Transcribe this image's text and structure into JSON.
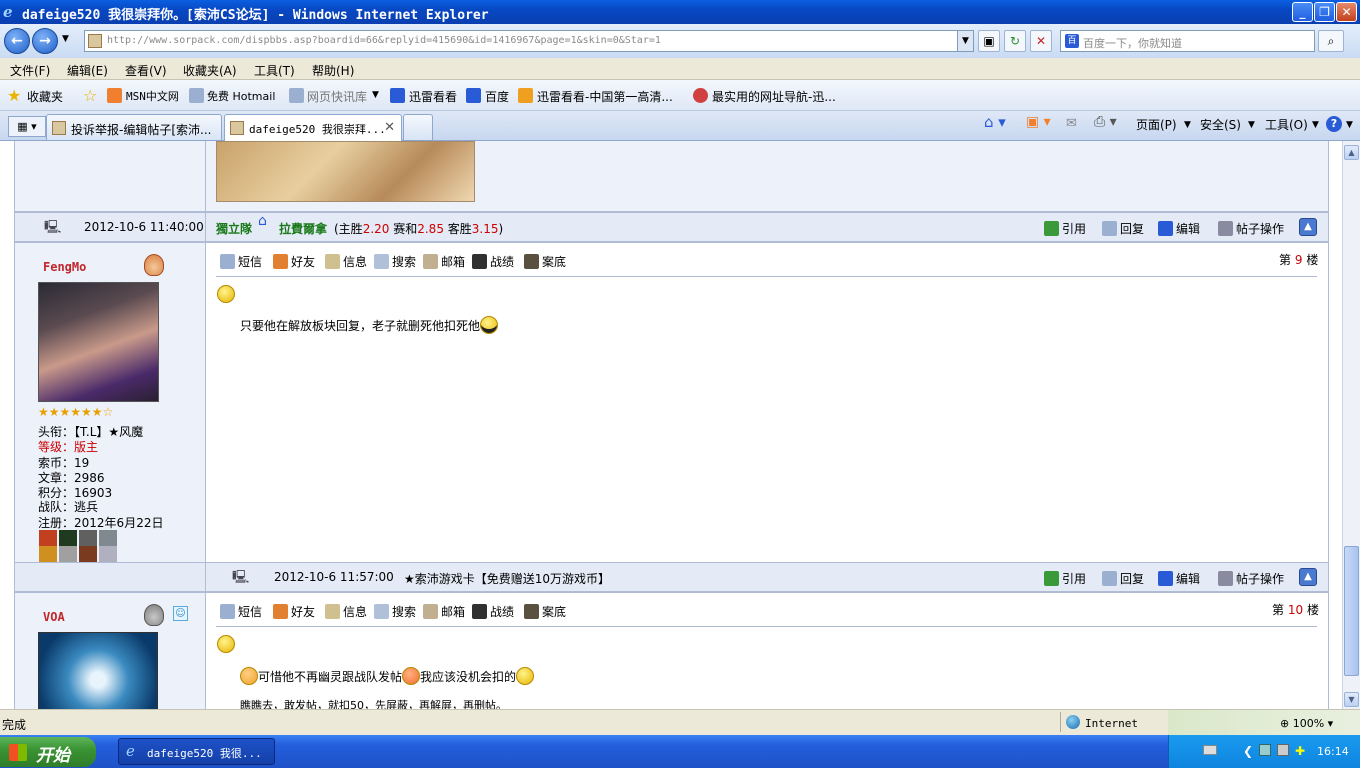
{
  "window": {
    "title": "dafeige520 我很崇拜你。[索沛CS论坛] - Windows Internet Explorer"
  },
  "address": {
    "url": "http://www.sorpack.com/dispbbs.asp?boardid=66&replyid=415690&id=1416967&page=1&skin=0&Star=1",
    "search_placeholder": "百度一下，你就知道"
  },
  "menu": [
    "文件(F)",
    "编辑(E)",
    "查看(V)",
    "收藏夹(A)",
    "工具(T)",
    "帮助(H)"
  ],
  "favorites": {
    "label": "收藏夹",
    "items": [
      "MSN中文网",
      "免费 Hotmail",
      "网页快讯库",
      "迅雷看看",
      "百度",
      "迅雷看看-中国第一高清...",
      "最实用的网址导航-迅..."
    ]
  },
  "tabs": [
    "投诉举报-编辑帖子[索沛...",
    "dafeige520 我很崇拜..."
  ],
  "commands": {
    "page": "页面(P)",
    "safety": "安全(S)",
    "tools": "工具(O)"
  },
  "post_actions": {
    "quote": "引用",
    "reply": "回复",
    "edit": "编辑",
    "manage": "帖子操作"
  },
  "user_actions": [
    "短信",
    "好友",
    "信息",
    "搜索",
    "邮箱",
    "战绩",
    "案底"
  ],
  "floor_prefix": "第",
  "floor_suffix": "楼",
  "post1": {
    "time": "2012-10-6 11:40:00",
    "sig_a": "獨立隊",
    "sig_b": "拉費爾拿",
    "sig_text1": "(主胜",
    "sig_v1": "2.20",
    "sig_text2": " 赛和",
    "sig_v2": "2.85",
    "sig_text3": " 客胜",
    "sig_v3": "3.15",
    "sig_text4": ")"
  },
  "post9": {
    "floor": "9",
    "user": "FengMo",
    "stars": "★★★★★★☆",
    "title_label": "头衔：",
    "title_value": "【T.L】★风魔",
    "level_label": "等级：",
    "level_value": "版主",
    "coins_label": "索币：",
    "coins_value": "19",
    "articles_label": "文章：",
    "articles_value": "2986",
    "points_label": "积分：",
    "points_value": "16903",
    "team_label": "战队：",
    "team_value": "逃兵",
    "reg_label": "注册：",
    "reg_value": "2012年6月22日",
    "body": "只要他在解放板块回复，老子就删死他扣死他"
  },
  "post9_footer": {
    "time": "2012-10-6 11:57:00",
    "sig": "★索沛游戏卡【免费赠送10万游戏币】"
  },
  "post10": {
    "floor": "10",
    "user": "VOA",
    "body1_a": "可惜他不再幽灵跟战队发帖",
    "body1_b": "我应该没机会扣的",
    "body2": "瞧瞧去，敢发帖，就扣50，先屏蔽，再解屏，再删帖。"
  },
  "status": {
    "done": "完成",
    "zone": "Internet",
    "zoom": "100%"
  },
  "taskbar": {
    "start": "开始",
    "task": "dafeige520 我很...",
    "clock": "16:14"
  }
}
